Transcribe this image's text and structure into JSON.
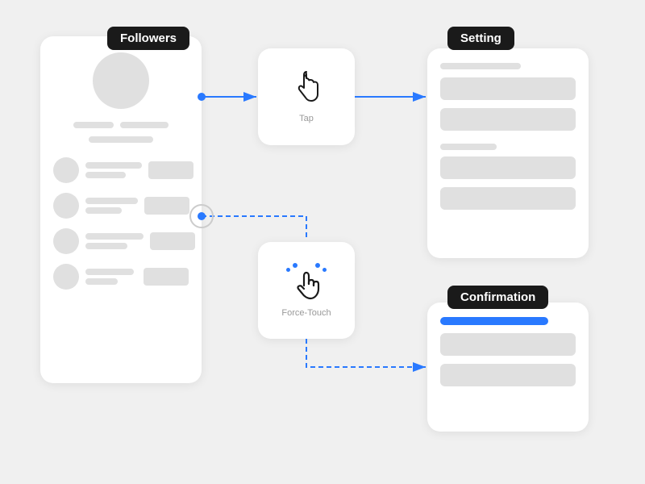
{
  "labels": {
    "followers": "Followers",
    "setting": "Setting",
    "confirmation": "Confirmation",
    "tap": "Tap",
    "force_touch": "Force-Touch"
  },
  "colors": {
    "blue": "#2979ff",
    "card_bg": "#ffffff",
    "bar": "#e0e0e0",
    "tag_bg": "#1a1a1a",
    "tag_text": "#ffffff",
    "bg": "#f0f0f0"
  }
}
